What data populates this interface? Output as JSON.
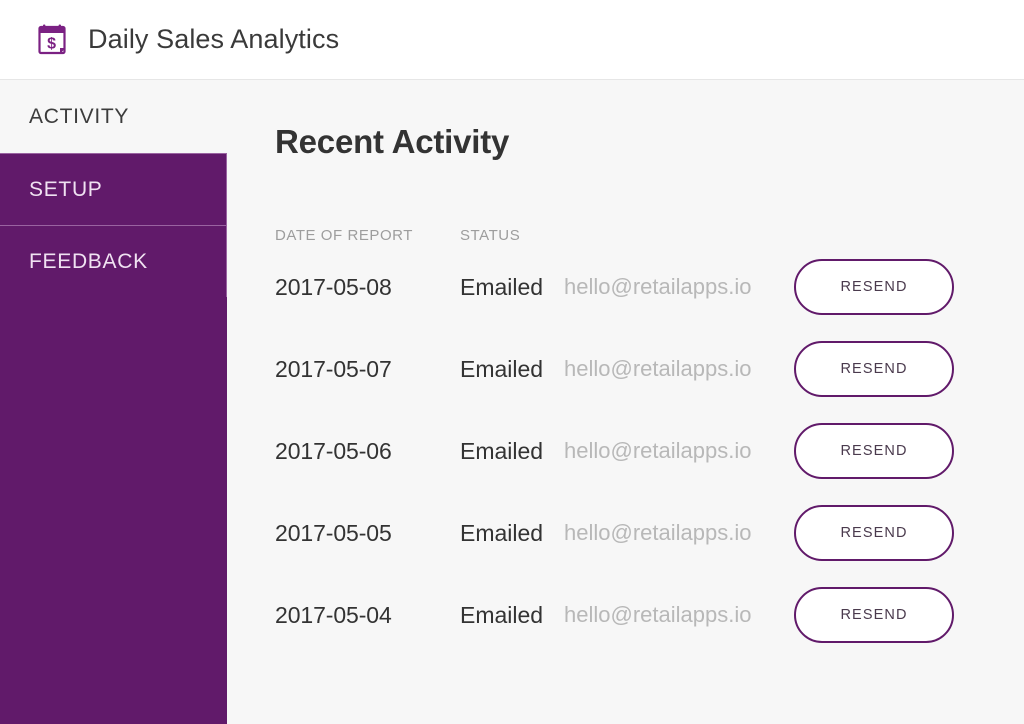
{
  "header": {
    "title": "Daily Sales Analytics",
    "icon": "calendar-dollar-icon"
  },
  "sidebar": {
    "items": [
      {
        "label": "ACTIVITY",
        "state": "active"
      },
      {
        "label": "SETUP",
        "state": "inactive"
      },
      {
        "label": "FEEDBACK",
        "state": "inactive"
      }
    ]
  },
  "main": {
    "page_title": "Recent Activity",
    "table": {
      "columns": [
        {
          "key": "date",
          "label": "DATE OF REPORT"
        },
        {
          "key": "status",
          "label": "STATUS"
        },
        {
          "key": "email",
          "label": ""
        },
        {
          "key": "action",
          "label": ""
        }
      ],
      "action_label": "RESEND",
      "rows": [
        {
          "date": "2017-05-08",
          "status": "Emailed",
          "email": "hello@retailapps.io",
          "action": "RESEND"
        },
        {
          "date": "2017-05-07",
          "status": "Emailed",
          "email": "hello@retailapps.io",
          "action": "RESEND"
        },
        {
          "date": "2017-05-06",
          "status": "Emailed",
          "email": "hello@retailapps.io",
          "action": "RESEND"
        },
        {
          "date": "2017-05-05",
          "status": "Emailed",
          "email": "hello@retailapps.io",
          "action": "RESEND"
        },
        {
          "date": "2017-05-04",
          "status": "Emailed",
          "email": "hello@retailapps.io",
          "action": "RESEND"
        }
      ]
    }
  },
  "colors": {
    "brand_purple": "#611a6a",
    "nav_divider": "#9a63a1",
    "page_background": "#f7f7f7",
    "header_background": "#ffffff",
    "muted_text": "#9d9d9d",
    "email_text": "#b8b8b8",
    "primary_text": "#333333"
  }
}
